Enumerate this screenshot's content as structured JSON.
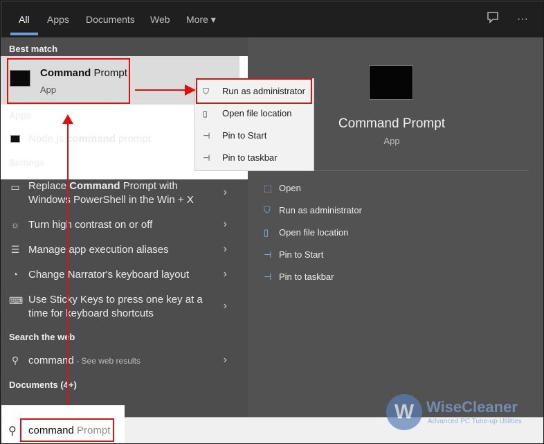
{
  "tabs": {
    "all": "All",
    "apps": "Apps",
    "documents": "Documents",
    "web": "Web",
    "more": "More ▾"
  },
  "top_icons": {
    "feedback": "feedback-icon",
    "more": "ellipsis-icon"
  },
  "left": {
    "best_match_label": "Best match",
    "best_match_title_bold": "Command",
    "best_match_title_rest": " Prompt",
    "best_match_subtitle": "App",
    "apps_label": "Apps",
    "app_item": {
      "pre": "Node.js ",
      "bold": "command",
      "post": " prompt"
    },
    "settings_label": "Settings",
    "settings": [
      {
        "line1_pre": "Replace ",
        "line1_bold": "Command",
        "line1_post": " Prompt with",
        "line2": "Windows PowerShell in the Win + X"
      },
      {
        "text": "Turn high contrast on or off"
      },
      {
        "text": "Manage app execution aliases"
      },
      {
        "text": "Change Narrator's keyboard layout"
      },
      {
        "line1": "Use Sticky Keys to press one key at a",
        "line2": "time for keyboard shortcuts"
      }
    ],
    "web_label": "Search the web",
    "web_item": {
      "query": "command",
      "hint": " - See web results"
    },
    "documents_label": "Documents (4+)"
  },
  "context_menu": [
    {
      "icon": "shield-icon",
      "label": "Run as administrator"
    },
    {
      "icon": "folder-icon",
      "label": "Open file location"
    },
    {
      "icon": "pin-icon",
      "label": "Pin to Start"
    },
    {
      "icon": "pin-icon",
      "label": "Pin to taskbar"
    }
  ],
  "right": {
    "title": "Command Prompt",
    "subtitle": "App",
    "actions": [
      {
        "icon": "open-icon",
        "label": "Open"
      },
      {
        "icon": "shield-icon",
        "label": "Run as administrator"
      },
      {
        "icon": "folder-icon",
        "label": "Open file location"
      },
      {
        "icon": "pin-icon",
        "label": "Pin to Start"
      },
      {
        "icon": "pin-icon",
        "label": "Pin to taskbar"
      }
    ]
  },
  "search": {
    "typed": "command",
    "suggestion": " Prompt"
  },
  "watermark": {
    "title": "WiseCleaner",
    "subtitle": "Advanced PC Tune-up Utilities",
    "logo": "W"
  },
  "colors": {
    "highlight": "#e01010",
    "accent": "#6a9dde"
  }
}
